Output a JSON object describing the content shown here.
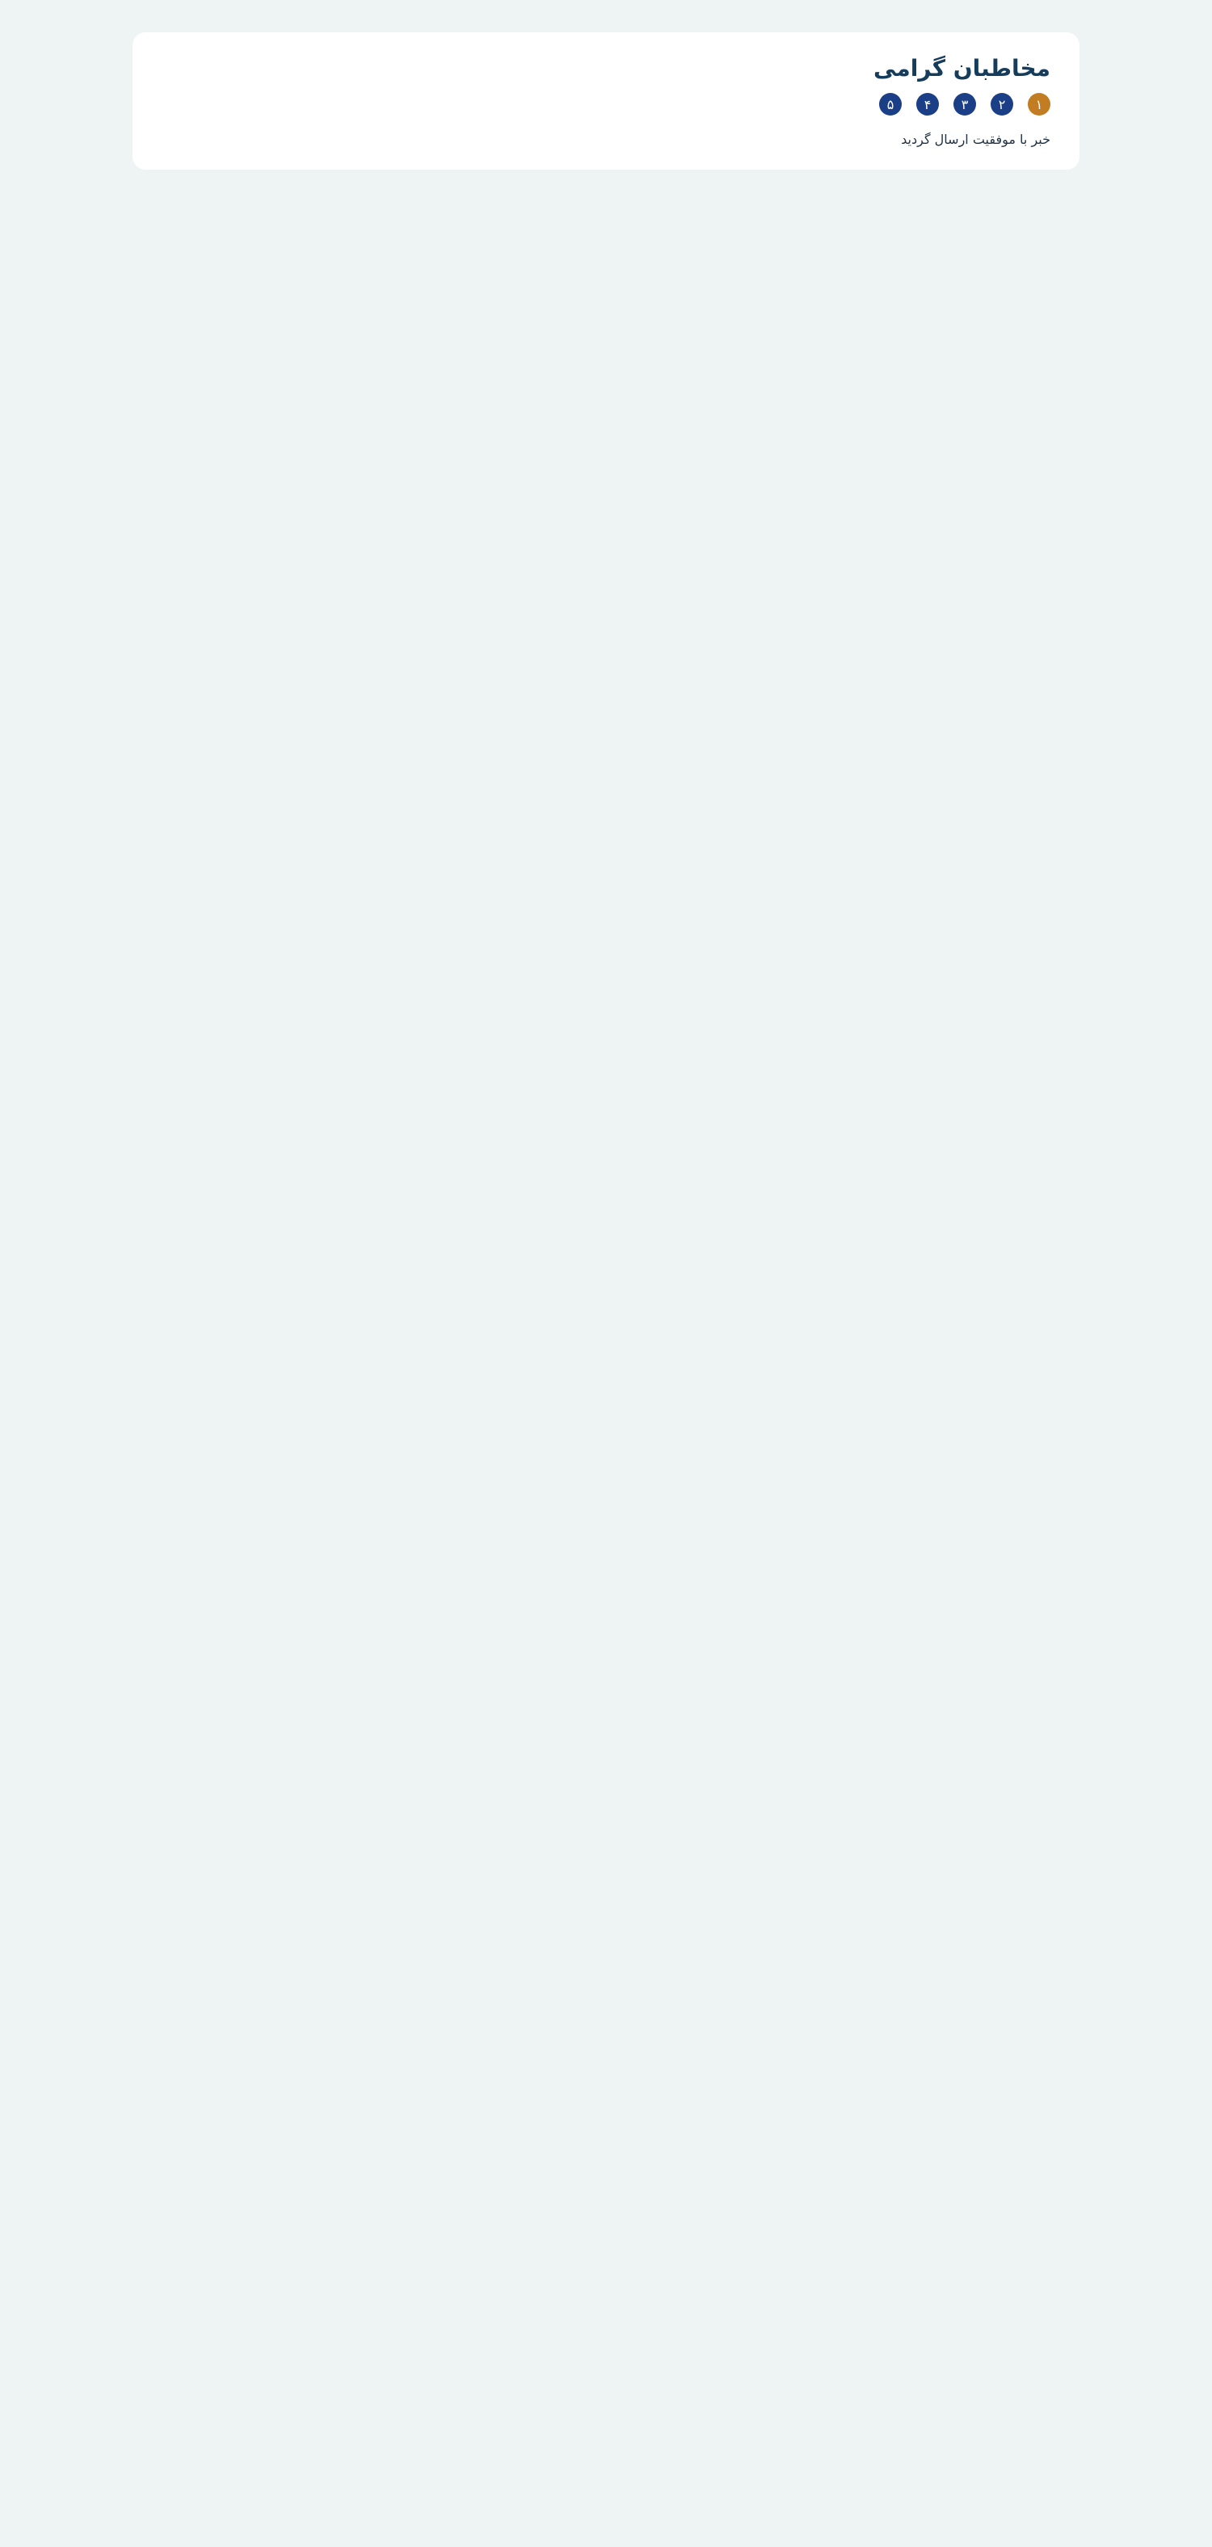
{
  "header": {
    "title": "مخاطبان گرامی"
  },
  "steps": [
    "۱",
    "۲",
    "۳",
    "۴",
    "۵"
  ],
  "main": {
    "message": "خبر با موفقیت ارسال گردید"
  }
}
